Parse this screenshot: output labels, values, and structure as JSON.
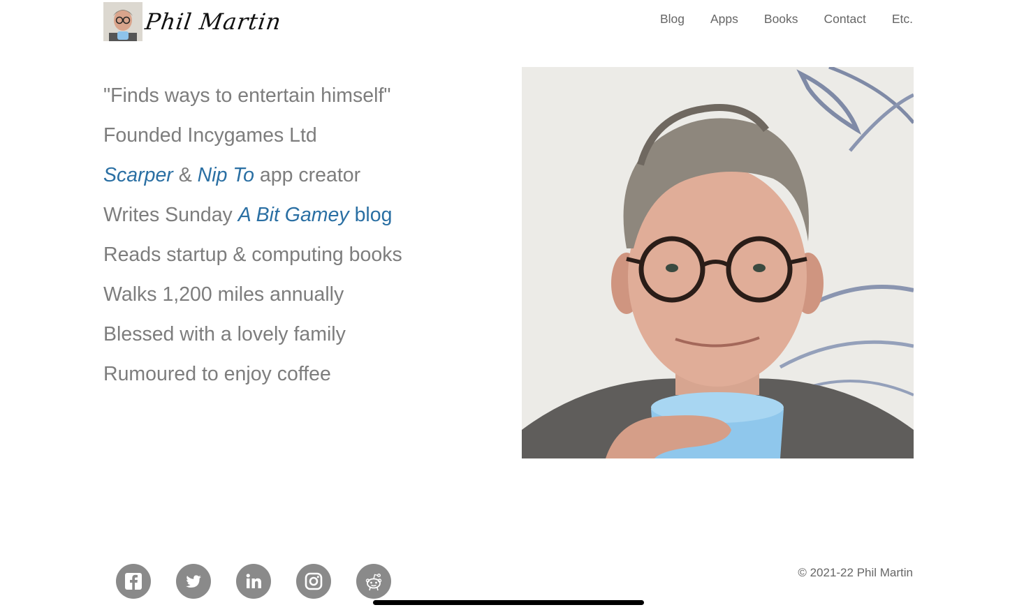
{
  "header": {
    "logo_text": "Phil Martin",
    "nav": [
      "Blog",
      "Apps",
      "Books",
      "Contact",
      "Etc."
    ]
  },
  "bio": {
    "l1": "\"Finds ways to entertain himself\"",
    "l2": "Founded Incygames Ltd",
    "l3": {
      "link1": "Scarper",
      "amp": " & ",
      "link2": "Nip To",
      "rest": " app creator"
    },
    "l4": {
      "pre": "Writes Sunday ",
      "link_it": "A Bit Gamey",
      "link_plain": " blog"
    },
    "l5": "Reads startup & computing books",
    "l6": "Walks 1,200 miles annually",
    "l7": "Blessed with a lovely family",
    "l8": "Rumoured to enjoy coffee"
  },
  "social": [
    "facebook-icon",
    "twitter-icon",
    "linkedin-icon",
    "instagram-icon",
    "reddit-icon"
  ],
  "footer": {
    "copyright": "© 2021-22 Phil Martin"
  },
  "colors": {
    "text": "#7d7d7d",
    "link": "#2a6fa3",
    "nav": "#666666",
    "icon_bg": "#8a8a8a"
  }
}
